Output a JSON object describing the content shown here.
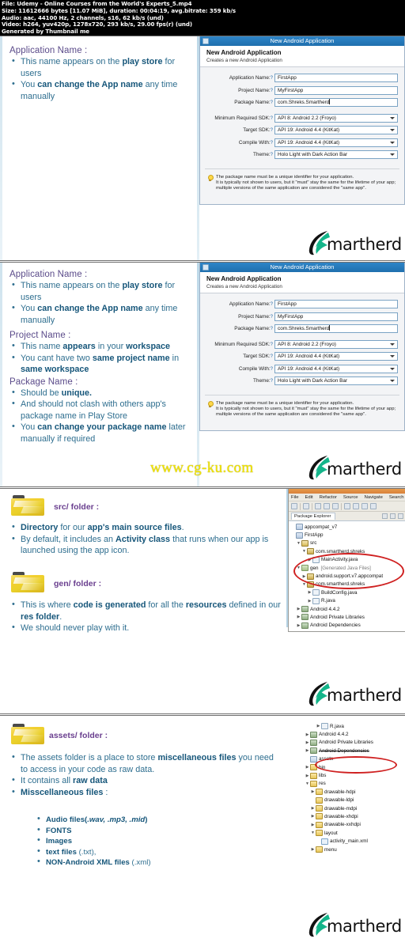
{
  "meta": {
    "lines": [
      "File: Udemy - Online Courses from the World's Experts_5.mp4",
      "Size: 11612666 bytes [11.07 MiB], duration: 00:04:19, avg.bitrate: 359 kb/s",
      "Audio: aac, 44100 Hz, 2 channels, s16, 62 kb/s (und)",
      "Video: h264, yuv420p, 1278x720, 293 kb/s, 29.00 fps(r) (und)",
      "Generated by Thumbnail me"
    ]
  },
  "brand": {
    "name": "martherd",
    "watermark": "www.cg-ku.com"
  },
  "dialog": {
    "window_title": "New Android Application",
    "heading": "New Android Application",
    "subheading": "Creates a new Android Application",
    "fields": [
      {
        "label": "Application Name:",
        "value": "FirstApp"
      },
      {
        "label": "Project Name:",
        "value": "MyFirstApp"
      },
      {
        "label": "Package Name:",
        "value": "com.Shreks.Smartherd"
      }
    ],
    "selects": [
      {
        "label": "Minimum Required SDK:",
        "value": "API 8: Android 2.2 (Froyo)"
      },
      {
        "label": "Target SDK:",
        "value": "API 19: Android 4.4 (KitKat)"
      },
      {
        "label": "Compile With:",
        "value": "API 19: Android 4.4 (KitKat)"
      },
      {
        "label": "Theme:",
        "value": "Holo Light with Dark Action Bar"
      }
    ],
    "note": [
      "The package name must be a unique identifier for your application.",
      "It is typically not shown to users, but it \"must\" stay the same for the lifetime of your app;",
      "multiple versions of the same application are considered the \"same app\"."
    ]
  },
  "slide1": {
    "sections": [
      {
        "title": "Application Name :",
        "bullets": [
          [
            {
              "t": "This name appears on the ",
              "b": false
            },
            {
              "t": "play store",
              "b": true
            },
            {
              "t": " for users",
              "b": false
            }
          ],
          [
            {
              "t": "You ",
              "b": false
            },
            {
              "t": "can change the App name",
              "b": true
            },
            {
              "t": " any time manually",
              "b": false
            }
          ]
        ]
      }
    ]
  },
  "slide2": {
    "sections": [
      {
        "title": "Application Name :",
        "bullets": [
          [
            {
              "t": "This name appears on the ",
              "b": false
            },
            {
              "t": "play store",
              "b": true
            },
            {
              "t": " for users",
              "b": false
            }
          ],
          [
            {
              "t": "You ",
              "b": false
            },
            {
              "t": "can change the App name",
              "b": true
            },
            {
              "t": " any time manually",
              "b": false
            }
          ]
        ]
      },
      {
        "title": "Project Name :",
        "bullets": [
          [
            {
              "t": "This name ",
              "b": false
            },
            {
              "t": "appears",
              "b": true
            },
            {
              "t": " in your ",
              "b": false
            },
            {
              "t": "workspace",
              "b": true
            }
          ],
          [
            {
              "t": "You cant have two ",
              "b": false
            },
            {
              "t": "same project name",
              "b": true
            },
            {
              "t": " in ",
              "b": false
            },
            {
              "t": "same workspace",
              "b": true
            }
          ]
        ]
      },
      {
        "title": "Package Name :",
        "bullets": [
          [
            {
              "t": "Should be ",
              "b": false
            },
            {
              "t": "unique.",
              "b": true
            }
          ],
          [
            {
              "t": "And should not clash with others app's package name in Play Store",
              "b": false
            }
          ],
          [
            {
              "t": "You ",
              "b": false
            },
            {
              "t": "can change your package name",
              "b": true
            },
            {
              "t": " later manually if required",
              "b": false
            }
          ]
        ]
      }
    ]
  },
  "slide3": {
    "folders": [
      {
        "name": "src/ folder :",
        "bullets": [
          [
            {
              "t": "Directory",
              "b": true
            },
            {
              "t": " for our ",
              "b": false
            },
            {
              "t": "app's main source files",
              "b": true
            },
            {
              "t": ".",
              "b": false
            }
          ],
          [
            {
              "t": "By default,  it includes an ",
              "b": false
            },
            {
              "t": "Activity class",
              "b": true
            },
            {
              "t": " that runs when our app is launched using the app icon.",
              "b": false
            }
          ]
        ]
      },
      {
        "name": "gen/ folder :",
        "bullets": [
          [
            {
              "t": "This is where ",
              "b": false
            },
            {
              "t": "code is generated",
              "b": true
            },
            {
              "t": " for all the ",
              "b": false
            },
            {
              "t": "resources",
              "b": true
            },
            {
              "t": " defined in our ",
              "b": false
            },
            {
              "t": "res folder",
              "b": true
            },
            {
              "t": ".",
              "b": false
            }
          ],
          [
            {
              "t": "We should never play with it.",
              "b": false
            }
          ]
        ]
      }
    ],
    "eclipse": {
      "menu": [
        "File",
        "Edit",
        "Refactor",
        "Source",
        "Navigate",
        "Search"
      ],
      "view_tab": "Package Explorer",
      "tree": [
        {
          "label": "appcompat_v7",
          "depth": 0,
          "arrow": "none",
          "icon": "proj"
        },
        {
          "label": "FirstApp",
          "depth": 0,
          "arrow": "none",
          "icon": "proj"
        },
        {
          "label": "src",
          "depth": 1,
          "arrow": "open",
          "icon": "srcf"
        },
        {
          "label": "com.smartherd.shreks",
          "depth": 2,
          "arrow": "open",
          "icon": "pkg"
        },
        {
          "label": "MainActivity.java",
          "depth": 3,
          "arrow": "closed",
          "icon": "java"
        },
        {
          "label": "gen",
          "depth": 1,
          "arrow": "open",
          "icon": "gen",
          "suffix": "[Generated Java Files]"
        },
        {
          "label": "android.support.v7.appcompat",
          "depth": 2,
          "arrow": "closed",
          "icon": "pkg"
        },
        {
          "label": "com.smartherd.shreks",
          "depth": 2,
          "arrow": "open",
          "icon": "pkg"
        },
        {
          "label": "BuildConfig.java",
          "depth": 3,
          "arrow": "closed",
          "icon": "java"
        },
        {
          "label": "R.java",
          "depth": 3,
          "arrow": "closed",
          "icon": "java"
        },
        {
          "label": "Android 4.4.2",
          "depth": 1,
          "arrow": "closed",
          "icon": "lib"
        },
        {
          "label": "Android Private Libraries",
          "depth": 1,
          "arrow": "closed",
          "icon": "lib"
        },
        {
          "label": "Android Dependencies",
          "depth": 1,
          "arrow": "closed",
          "icon": "lib"
        }
      ]
    }
  },
  "slide4": {
    "folder": {
      "name": "assets/ folder :",
      "bullets": [
        [
          {
            "t": "The assets folder is a place to store ",
            "b": false
          },
          {
            "t": "miscellaneous files",
            "b": true
          },
          {
            "t": " you need to access in your code as raw data.",
            "b": false
          }
        ],
        [
          {
            "t": "It contains all ",
            "b": false
          },
          {
            "t": "raw data",
            "b": true
          }
        ],
        [
          {
            "t": "Misscellaneous files",
            "b": true
          },
          {
            "t": " :",
            "b": false
          }
        ]
      ],
      "sub_bullets": [
        [
          {
            "t": "Audio files(",
            "b": true
          },
          {
            "t": ".wav, .mp3, .mid",
            "b": true,
            "i": true
          },
          {
            "t": ")",
            "b": true
          }
        ],
        [
          {
            "t": "FONTS",
            "b": true
          }
        ],
        [
          {
            "t": "Images",
            "b": true
          }
        ],
        [
          {
            "t": "text files",
            "b": true
          },
          {
            "t": " (.txt),",
            "b": false
          }
        ],
        [
          {
            "t": "NON-Android XML files",
            "b": true
          },
          {
            "t": " (.xml)",
            "b": false
          }
        ]
      ]
    },
    "tree": [
      {
        "label": "R.java",
        "depth": 3,
        "arrow": "closed",
        "icon": "java"
      },
      {
        "label": "Android 4.4.2",
        "depth": 1,
        "arrow": "closed",
        "icon": "lib"
      },
      {
        "label": "Android Private Libraries",
        "depth": 1,
        "arrow": "closed",
        "icon": "lib"
      },
      {
        "label": "Android Dependencies",
        "depth": 1,
        "arrow": "closed",
        "icon": "lib"
      },
      {
        "label": "assets",
        "depth": 1,
        "arrow": "none",
        "icon": "assets"
      },
      {
        "label": "bin",
        "depth": 1,
        "arrow": "closed",
        "icon": "folder2"
      },
      {
        "label": "libs",
        "depth": 1,
        "arrow": "closed",
        "icon": "folder2"
      },
      {
        "label": "res",
        "depth": 1,
        "arrow": "open",
        "icon": "folder2"
      },
      {
        "label": "drawable-hdpi",
        "depth": 2,
        "arrow": "closed",
        "icon": "folder2"
      },
      {
        "label": "drawable-ldpi",
        "depth": 2,
        "arrow": "none",
        "icon": "folder2"
      },
      {
        "label": "drawable-mdpi",
        "depth": 2,
        "arrow": "closed",
        "icon": "folder2"
      },
      {
        "label": "drawable-xhdpi",
        "depth": 2,
        "arrow": "closed",
        "icon": "folder2"
      },
      {
        "label": "drawable-xxhdpi",
        "depth": 2,
        "arrow": "closed",
        "icon": "folder2"
      },
      {
        "label": "layout",
        "depth": 2,
        "arrow": "open",
        "icon": "folder2"
      },
      {
        "label": "activity_main.xml",
        "depth": 3,
        "arrow": "none",
        "icon": "xml"
      },
      {
        "label": "menu",
        "depth": 2,
        "arrow": "closed",
        "icon": "folder2"
      }
    ]
  }
}
